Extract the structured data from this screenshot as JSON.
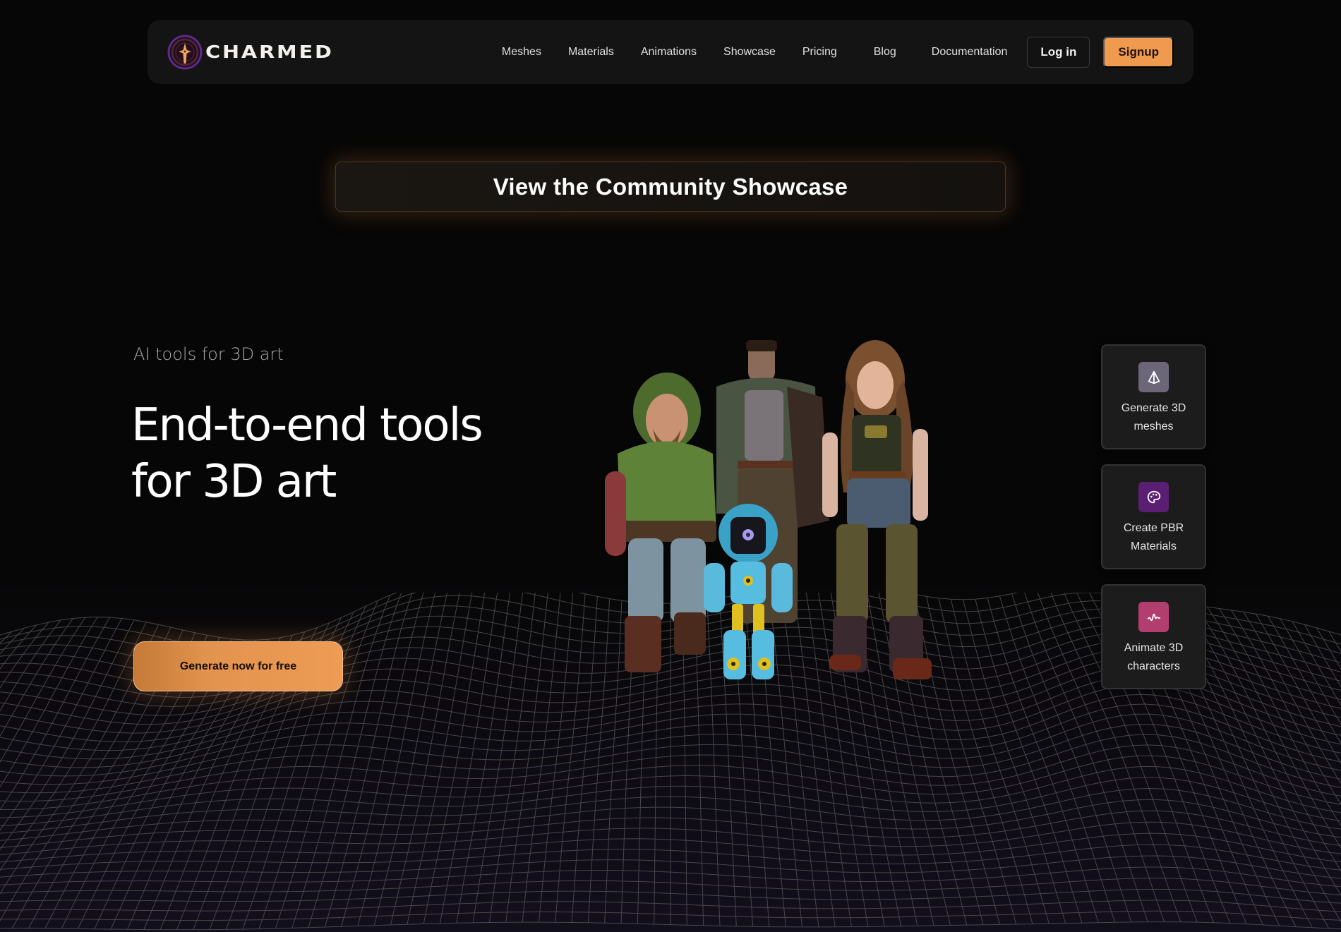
{
  "brand": {
    "name": "CHARMED",
    "logo_icon": "star-in-rings-icon"
  },
  "nav": {
    "links": [
      "Meshes",
      "Materials",
      "Animations",
      "Showcase",
      "Pricing",
      "Blog",
      "Documentation"
    ],
    "login_label": "Log in",
    "signup_label": "Signup"
  },
  "showcase_banner": {
    "label": "View the Community Showcase"
  },
  "hero": {
    "eyebrow": "AI tools for 3D art",
    "headline_line1": "End-to-end tools",
    "headline_line2": "for 3D art",
    "cta_label": "Generate now for free",
    "image_alt": "Group of 3D characters: hooded archer, tall man in cloak, female adventurer and small blue robot standing on wireframe terrain"
  },
  "features": [
    {
      "label_line1": "Generate 3D",
      "label_line2": "meshes",
      "icon": "pyramid-mesh-icon",
      "color": "#6b6779"
    },
    {
      "label_line1": "Create PBR",
      "label_line2": "Materials",
      "icon": "palette-icon",
      "color": "#5a1f73"
    },
    {
      "label_line1": "Animate 3D",
      "label_line2": "characters",
      "icon": "waveform-icon",
      "color": "#b23d6f"
    }
  ],
  "colors": {
    "accent": "#ef9a4f",
    "background": "#060606",
    "navbar": "#141414",
    "logo_purple": "#6a2a9a",
    "logo_gold": "#f2a85a"
  }
}
